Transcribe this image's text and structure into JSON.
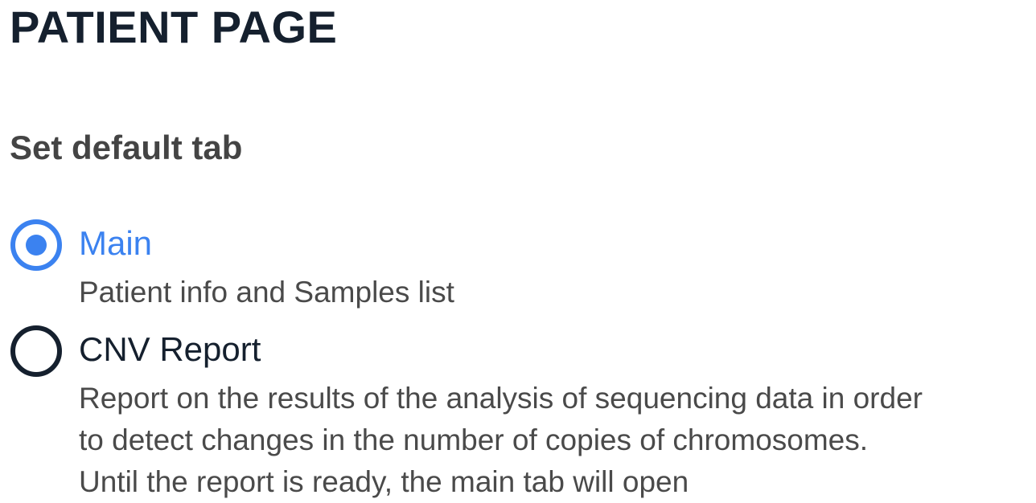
{
  "page": {
    "title": "PATIENT PAGE"
  },
  "default_tab": {
    "heading": "Set default tab",
    "options": [
      {
        "label": "Main",
        "description": "Patient info and Samples list",
        "selected": true
      },
      {
        "label": "CNV Report",
        "description_lines": [
          "Report on the results of the analysis of sequencing data in order",
          "to detect changes in the number of copies of chromosomes.",
          "Until the report is ready, the main tab will open"
        ],
        "selected": false
      }
    ]
  },
  "colors": {
    "accent": "#3b82f0",
    "title_text": "#15202e",
    "heading_text": "#444444",
    "description_text": "#4a4a4a"
  }
}
